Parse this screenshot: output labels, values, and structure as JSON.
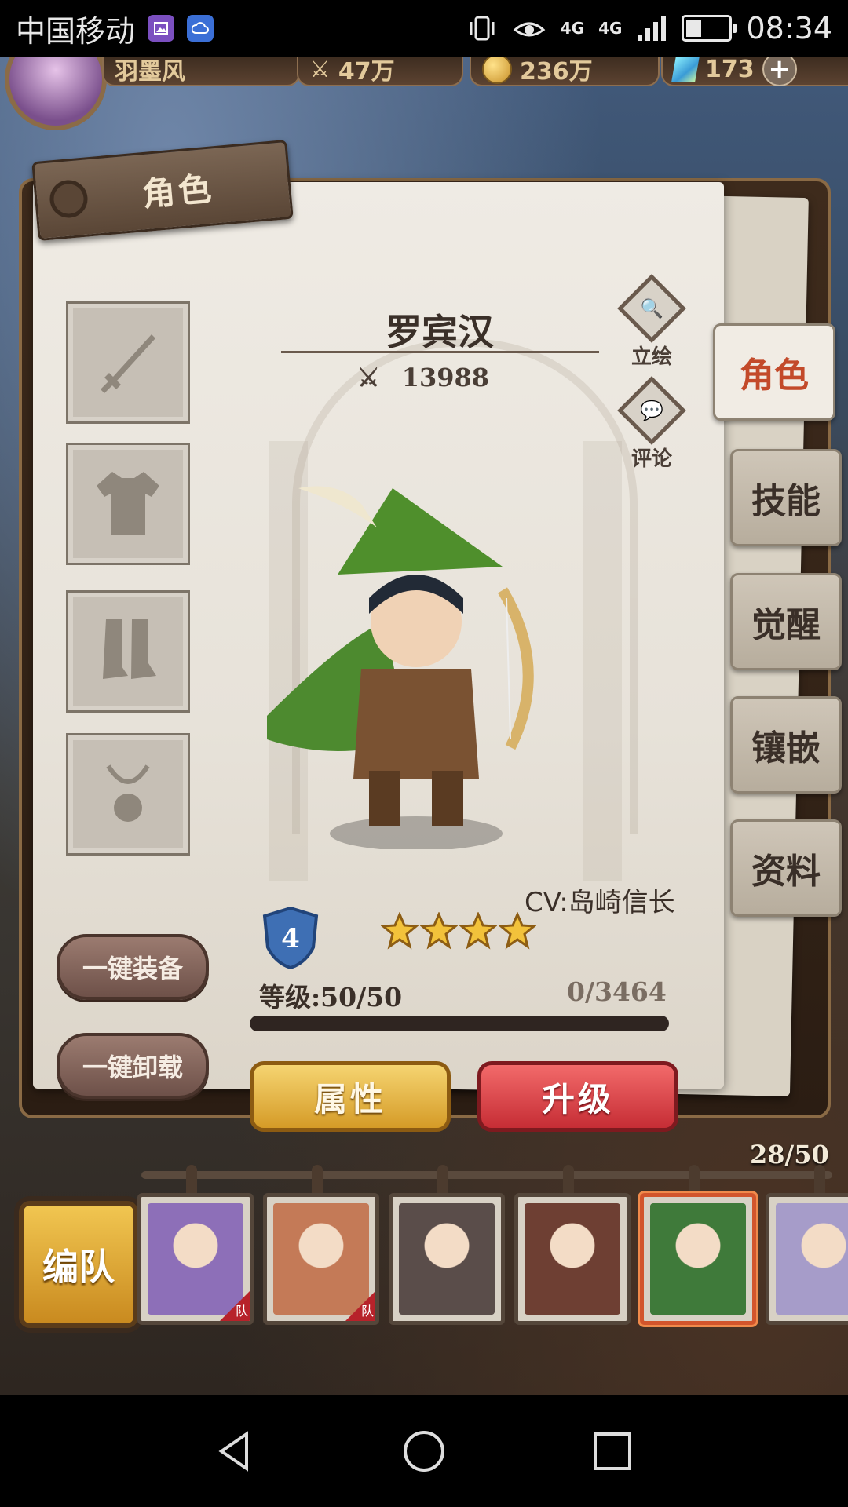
{
  "status_bar": {
    "carrier": "中国移动",
    "network_1": "4G",
    "network_2": "4G",
    "time": "08:34",
    "battery_percent": 35
  },
  "top_bar": {
    "player_name": "羽墨风",
    "stamina": "47万",
    "gold": "236万",
    "gems": "173",
    "plus": "+"
  },
  "panel": {
    "title": "角色",
    "character_name": "罗宾汉",
    "power": "13988",
    "portrait_label": "立绘",
    "comment_label": "评论",
    "cv": "CV:岛崎信长",
    "rank": "4",
    "stars": 4,
    "level": "等级:50/50",
    "exp": "0/3464",
    "exp_fraction": 0,
    "equip_all": "一键装备",
    "unequip_all": "一键卸载",
    "attributes": "属性",
    "upgrade": "升级"
  },
  "tabs": [
    {
      "label": "角色",
      "active": true
    },
    {
      "label": "技能",
      "active": false
    },
    {
      "label": "觉醒",
      "active": false
    },
    {
      "label": "镶嵌",
      "active": false
    },
    {
      "label": "资料",
      "active": false
    }
  ],
  "roster": {
    "count": "28/50",
    "team_button": "编队",
    "team_tag": "队",
    "cards": [
      {
        "name": "roster-card-1",
        "in_team": true,
        "selected": false,
        "color": "#8d6fb8"
      },
      {
        "name": "roster-card-2",
        "in_team": true,
        "selected": false,
        "color": "#c47a57"
      },
      {
        "name": "roster-card-3",
        "in_team": false,
        "selected": false,
        "color": "#5a4d4a"
      },
      {
        "name": "roster-card-4",
        "in_team": false,
        "selected": false,
        "color": "#6e3f33"
      },
      {
        "name": "roster-card-5",
        "in_team": false,
        "selected": true,
        "color": "#3f7a3a"
      },
      {
        "name": "roster-card-6",
        "in_team": false,
        "selected": false,
        "color": "#a69cc9"
      }
    ]
  },
  "colors": {
    "active_tab_text": "#c34a2a",
    "upgrade_button": "#c62d35",
    "attributes_button": "#d59b27"
  }
}
